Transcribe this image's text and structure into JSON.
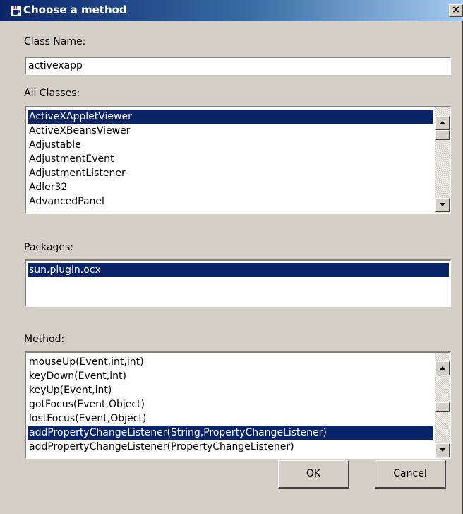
{
  "window": {
    "title": "Choose a method",
    "close_label": "×"
  },
  "class_name": {
    "label": "Class Name:",
    "value": "activexapp"
  },
  "all_classes": {
    "label": "All Classes:",
    "items": [
      "ActiveXAppletViewer",
      "ActiveXBeansViewer",
      "Adjustable",
      "AdjustmentEvent",
      "AdjustmentListener",
      "Adler32",
      "AdvancedPanel"
    ],
    "selected": "ActiveXAppletViewer"
  },
  "packages": {
    "label": "Packages:",
    "items": [
      "sun.plugin.ocx"
    ],
    "selected": "sun.plugin.ocx"
  },
  "methods": {
    "label": "Method:",
    "items": [
      "mouseUp(Event,int,int)",
      "keyDown(Event,int)",
      "keyUp(Event,int)",
      "gotFocus(Event,Object)",
      "lostFocus(Event,Object)",
      "addPropertyChangeListener(String,PropertyChangeListener)",
      "addPropertyChangeListener(PropertyChangeListener)"
    ],
    "selected": "addPropertyChangeListener(String,PropertyChangeListener)"
  },
  "buttons": {
    "ok": "OK",
    "cancel": "Cancel"
  },
  "colors": {
    "selection": "#0a246a",
    "dialog_face": "#d4d0c8",
    "title_gradient_start": "#0a246a"
  }
}
